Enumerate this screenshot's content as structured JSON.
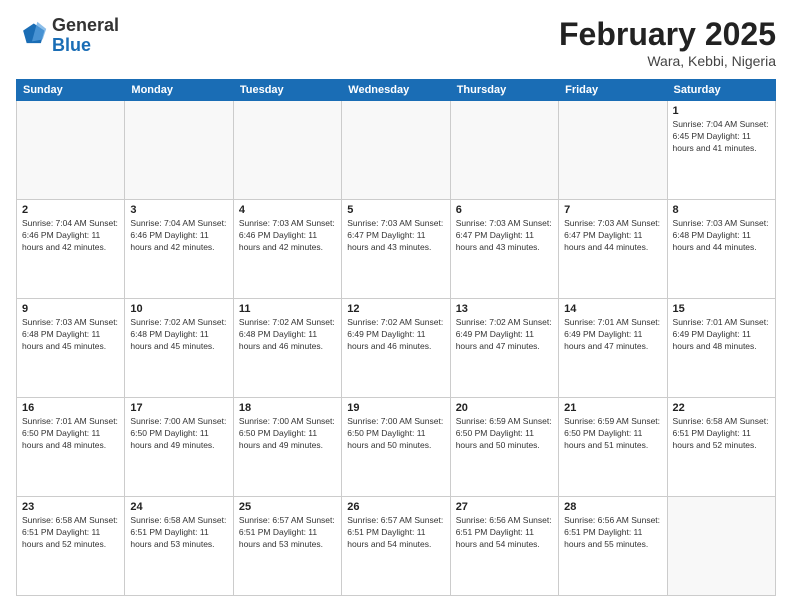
{
  "header": {
    "logo_general": "General",
    "logo_blue": "Blue",
    "month_title": "February 2025",
    "location": "Wara, Kebbi, Nigeria"
  },
  "days_of_week": [
    "Sunday",
    "Monday",
    "Tuesday",
    "Wednesday",
    "Thursday",
    "Friday",
    "Saturday"
  ],
  "weeks": [
    [
      {
        "day": "",
        "info": ""
      },
      {
        "day": "",
        "info": ""
      },
      {
        "day": "",
        "info": ""
      },
      {
        "day": "",
        "info": ""
      },
      {
        "day": "",
        "info": ""
      },
      {
        "day": "",
        "info": ""
      },
      {
        "day": "1",
        "info": "Sunrise: 7:04 AM\nSunset: 6:45 PM\nDaylight: 11 hours and 41 minutes."
      }
    ],
    [
      {
        "day": "2",
        "info": "Sunrise: 7:04 AM\nSunset: 6:46 PM\nDaylight: 11 hours and 42 minutes."
      },
      {
        "day": "3",
        "info": "Sunrise: 7:04 AM\nSunset: 6:46 PM\nDaylight: 11 hours and 42 minutes."
      },
      {
        "day": "4",
        "info": "Sunrise: 7:03 AM\nSunset: 6:46 PM\nDaylight: 11 hours and 42 minutes."
      },
      {
        "day": "5",
        "info": "Sunrise: 7:03 AM\nSunset: 6:47 PM\nDaylight: 11 hours and 43 minutes."
      },
      {
        "day": "6",
        "info": "Sunrise: 7:03 AM\nSunset: 6:47 PM\nDaylight: 11 hours and 43 minutes."
      },
      {
        "day": "7",
        "info": "Sunrise: 7:03 AM\nSunset: 6:47 PM\nDaylight: 11 hours and 44 minutes."
      },
      {
        "day": "8",
        "info": "Sunrise: 7:03 AM\nSunset: 6:48 PM\nDaylight: 11 hours and 44 minutes."
      }
    ],
    [
      {
        "day": "9",
        "info": "Sunrise: 7:03 AM\nSunset: 6:48 PM\nDaylight: 11 hours and 45 minutes."
      },
      {
        "day": "10",
        "info": "Sunrise: 7:02 AM\nSunset: 6:48 PM\nDaylight: 11 hours and 45 minutes."
      },
      {
        "day": "11",
        "info": "Sunrise: 7:02 AM\nSunset: 6:48 PM\nDaylight: 11 hours and 46 minutes."
      },
      {
        "day": "12",
        "info": "Sunrise: 7:02 AM\nSunset: 6:49 PM\nDaylight: 11 hours and 46 minutes."
      },
      {
        "day": "13",
        "info": "Sunrise: 7:02 AM\nSunset: 6:49 PM\nDaylight: 11 hours and 47 minutes."
      },
      {
        "day": "14",
        "info": "Sunrise: 7:01 AM\nSunset: 6:49 PM\nDaylight: 11 hours and 47 minutes."
      },
      {
        "day": "15",
        "info": "Sunrise: 7:01 AM\nSunset: 6:49 PM\nDaylight: 11 hours and 48 minutes."
      }
    ],
    [
      {
        "day": "16",
        "info": "Sunrise: 7:01 AM\nSunset: 6:50 PM\nDaylight: 11 hours and 48 minutes."
      },
      {
        "day": "17",
        "info": "Sunrise: 7:00 AM\nSunset: 6:50 PM\nDaylight: 11 hours and 49 minutes."
      },
      {
        "day": "18",
        "info": "Sunrise: 7:00 AM\nSunset: 6:50 PM\nDaylight: 11 hours and 49 minutes."
      },
      {
        "day": "19",
        "info": "Sunrise: 7:00 AM\nSunset: 6:50 PM\nDaylight: 11 hours and 50 minutes."
      },
      {
        "day": "20",
        "info": "Sunrise: 6:59 AM\nSunset: 6:50 PM\nDaylight: 11 hours and 50 minutes."
      },
      {
        "day": "21",
        "info": "Sunrise: 6:59 AM\nSunset: 6:50 PM\nDaylight: 11 hours and 51 minutes."
      },
      {
        "day": "22",
        "info": "Sunrise: 6:58 AM\nSunset: 6:51 PM\nDaylight: 11 hours and 52 minutes."
      }
    ],
    [
      {
        "day": "23",
        "info": "Sunrise: 6:58 AM\nSunset: 6:51 PM\nDaylight: 11 hours and 52 minutes."
      },
      {
        "day": "24",
        "info": "Sunrise: 6:58 AM\nSunset: 6:51 PM\nDaylight: 11 hours and 53 minutes."
      },
      {
        "day": "25",
        "info": "Sunrise: 6:57 AM\nSunset: 6:51 PM\nDaylight: 11 hours and 53 minutes."
      },
      {
        "day": "26",
        "info": "Sunrise: 6:57 AM\nSunset: 6:51 PM\nDaylight: 11 hours and 54 minutes."
      },
      {
        "day": "27",
        "info": "Sunrise: 6:56 AM\nSunset: 6:51 PM\nDaylight: 11 hours and 54 minutes."
      },
      {
        "day": "28",
        "info": "Sunrise: 6:56 AM\nSunset: 6:51 PM\nDaylight: 11 hours and 55 minutes."
      },
      {
        "day": "",
        "info": ""
      }
    ]
  ]
}
